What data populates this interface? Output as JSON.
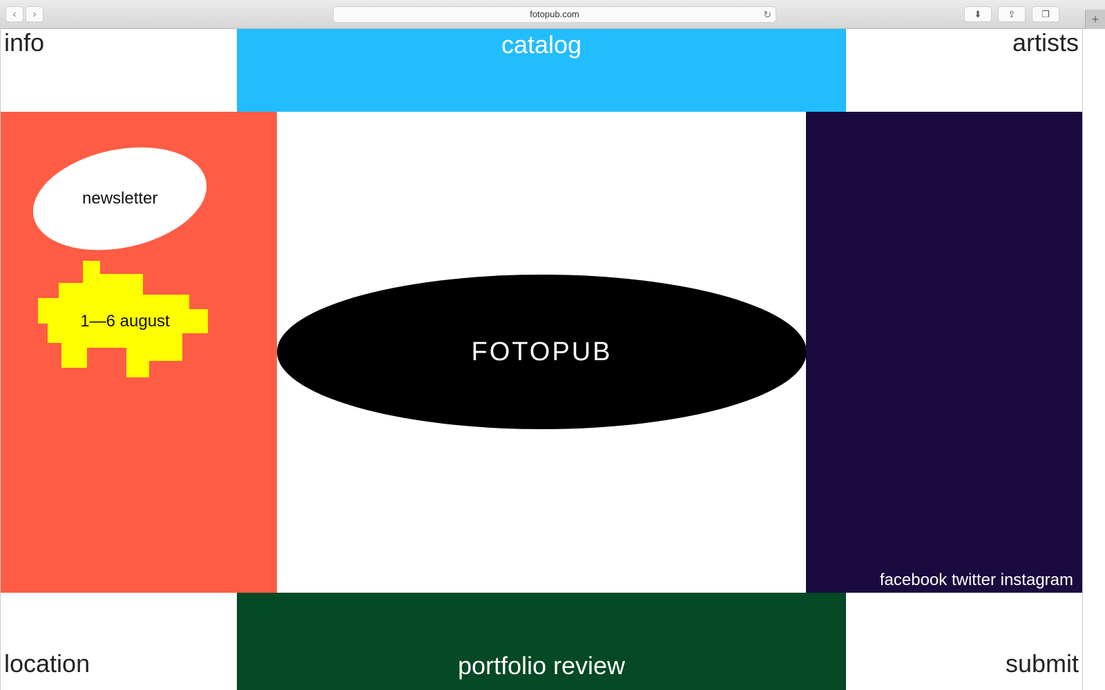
{
  "browser": {
    "url": "fotopub.com",
    "back": "‹",
    "forward": "›",
    "reload": "↻",
    "plus": "+"
  },
  "nav": {
    "info": "info",
    "catalog": "catalog",
    "artists": "artists",
    "location": "location",
    "portfolio_review": "portfolio review",
    "submit": "submit"
  },
  "left": {
    "newsletter": "newsletter",
    "dates": "1—6 august"
  },
  "center": {
    "logo": "FOTOPUB"
  },
  "right": {
    "social": "facebook twitter instagram"
  },
  "colors": {
    "catalog": "#22bdfe",
    "left_panel": "#ff5c45",
    "right_panel": "#1b0a3f",
    "portfolio": "#064926",
    "dates_shape": "#ffff00"
  }
}
